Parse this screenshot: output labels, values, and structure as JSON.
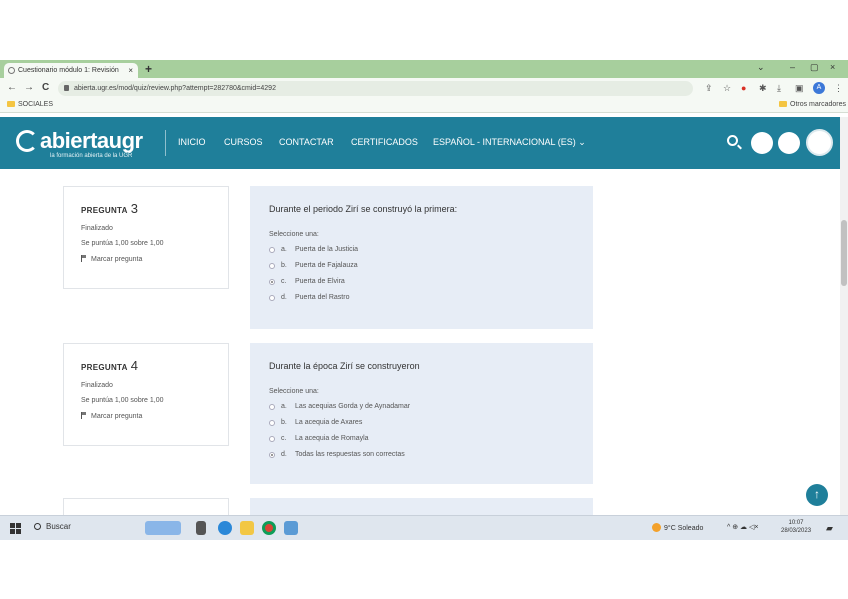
{
  "browser": {
    "tab_title": "Cuestionario módulo 1: Revisión",
    "tab_close": "×",
    "new_tab": "+",
    "window_controls": {
      "minimize": "–",
      "maximize": "▢",
      "close": "×",
      "menu": "⌄"
    },
    "nav": {
      "back": "←",
      "forward": "→",
      "reload": "C"
    },
    "url": "abierta.ugr.es/mod/quiz/review.php?attempt=282780&cmid=4292",
    "toolbar_icons": [
      "share-icon",
      "star-icon",
      "extension-icon",
      "puzzle-icon",
      "download-icon",
      "sidebar-icon"
    ],
    "profile_initial": "A",
    "menu_dots": "⋮",
    "bookmarks": {
      "left": "SOCIALES",
      "right": "Otros marcadores"
    }
  },
  "site": {
    "logo_name": "abiertaugr",
    "logo_tagline": "la formación abierta de la UGR",
    "nav": [
      "INICIO",
      "CURSOS",
      "CONTACTAR",
      "CERTIFICADOS",
      "ESPAÑOL - INTERNACIONAL (ES) ⌄"
    ],
    "brand_color": "#1f7f9a"
  },
  "questions": [
    {
      "label": "PREGUNTA",
      "number": "3",
      "status": "Finalizado",
      "score": "Se puntúa 1,00 sobre 1,00",
      "flag": "Marcar pregunta",
      "text": "Durante el periodo Zirí se construyó la primera:",
      "prompt": "Seleccione una:",
      "options": [
        {
          "letter": "a.",
          "text": "Puerta de la Justicia",
          "selected": false
        },
        {
          "letter": "b.",
          "text": "Puerta de Fajalauza",
          "selected": false
        },
        {
          "letter": "c.",
          "text": "Puerta de Elvira",
          "selected": true
        },
        {
          "letter": "d.",
          "text": "Puerta del Rastro",
          "selected": false
        }
      ]
    },
    {
      "label": "PREGUNTA",
      "number": "4",
      "status": "Finalizado",
      "score": "Se puntúa 1,00 sobre 1,00",
      "flag": "Marcar pregunta",
      "text": "Durante la época Zirí se construyeron",
      "prompt": "Seleccione una:",
      "options": [
        {
          "letter": "a.",
          "text": "Las acequias Gorda y de Aynadamar",
          "selected": false
        },
        {
          "letter": "b.",
          "text": "La acequia de Axares",
          "selected": false
        },
        {
          "letter": "c.",
          "text": "La acequia de Romayla",
          "selected": false
        },
        {
          "letter": "d.",
          "text": "Todas las respuestas son correctas",
          "selected": true
        }
      ]
    }
  ],
  "taskbar": {
    "search": "Buscar",
    "weather": "9°C Soleado",
    "tray": "^ ⊕ ☁ ◁×",
    "time": "10:07",
    "date": "28/03/2023"
  }
}
